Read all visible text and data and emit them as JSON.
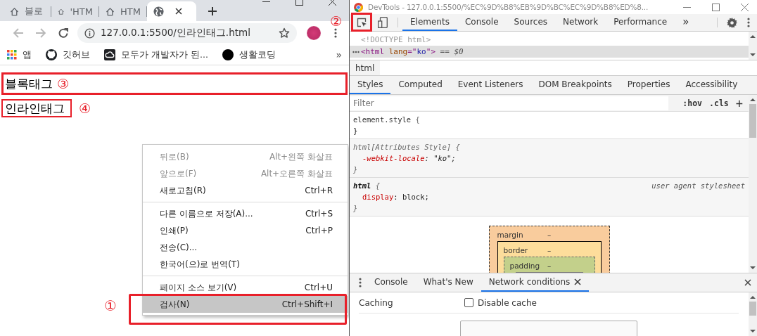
{
  "browser": {
    "tabs": [
      {
        "kind": "home",
        "label": "블로",
        "selected": false,
        "closable": false
      },
      {
        "kind": "home",
        "label": "'HTM",
        "selected": false,
        "closable": false
      },
      {
        "kind": "home",
        "label": "HTM",
        "selected": false,
        "closable": false
      },
      {
        "kind": "globe",
        "selected": true,
        "closable": true
      }
    ],
    "nav": {
      "back_disabled": true,
      "forward_disabled": true
    },
    "address": "127.0.0.1:5500/인라인태그.html",
    "menu_annotation": "②",
    "bookmarks": [
      {
        "kind": "apps",
        "label": "앱"
      },
      {
        "kind": "logo",
        "label": "깃허브"
      },
      {
        "kind": "cloud",
        "label": "모두가 개발자가 된..."
      },
      {
        "kind": "dot",
        "label": "생활코딩"
      }
    ],
    "bookmarks_overflow": "»",
    "page": {
      "block_text": "블록태그",
      "block_annotation": "③",
      "inline_text": "인라인태그",
      "inline_annotation": "④"
    },
    "context_menu": {
      "annotation": "①",
      "groups": [
        {
          "items": [
            {
              "label": "뒤로(B)",
              "shortcut": "Alt+왼쪽 화살표",
              "disabled": true,
              "selected": false
            },
            {
              "label": "앞으로(F)",
              "shortcut": "Alt+오른쪽 화살표",
              "disabled": true,
              "selected": false
            },
            {
              "label": "새로고침(R)",
              "shortcut": "Ctrl+R",
              "disabled": false,
              "selected": false
            }
          ]
        },
        {
          "items": [
            {
              "label": "다른 이름으로 저장(A)...",
              "shortcut": "Ctrl+S",
              "disabled": false,
              "selected": false
            },
            {
              "label": "인쇄(P)",
              "shortcut": "Ctrl+P",
              "disabled": false,
              "selected": false
            },
            {
              "label": "전송(C)...",
              "disabled": false,
              "selected": false
            },
            {
              "label": "한국어(으)로 번역(T)",
              "disabled": false,
              "selected": false
            }
          ]
        },
        {
          "items": [
            {
              "label": "페이지 소스 보기(V)",
              "shortcut": "Ctrl+U",
              "disabled": false,
              "selected": false
            },
            {
              "label": "검사(N)",
              "shortcut": "Ctrl+Shift+I",
              "disabled": false,
              "selected": true
            }
          ]
        }
      ]
    }
  },
  "devtools": {
    "title": "DevTools - 127.0.0.1:5500/%EC%9D%B8%EB%9D%BC%EC%9D%B8%ED%8...",
    "tabs": [
      {
        "label": "Elements",
        "selected": true
      },
      {
        "label": "Console",
        "selected": false
      },
      {
        "label": "Sources",
        "selected": false
      },
      {
        "label": "Network",
        "selected": false
      },
      {
        "label": "Performance",
        "selected": false
      }
    ],
    "tabs_overflow": "»",
    "dom": [
      {
        "selected": false,
        "tokens": [
          {
            "kind": "doctype",
            "text": "<!DOCTYPE html>"
          }
        ]
      },
      {
        "selected": true,
        "tokens": [
          {
            "kind": "tag",
            "text": "<html"
          },
          {
            "kind": "attr",
            "text": " lang"
          },
          {
            "kind": "punct",
            "text": "=\""
          },
          {
            "kind": "value",
            "text": "ko"
          },
          {
            "kind": "punct",
            "text": "\""
          },
          {
            "kind": "tag",
            "text": ">"
          },
          {
            "kind": "marker",
            "text": " == $0"
          }
        ]
      }
    ],
    "breadcrumb": "html",
    "style_tabs": [
      {
        "label": "Styles",
        "selected": true
      },
      {
        "label": "Computed",
        "selected": false
      },
      {
        "label": "Event Listeners",
        "selected": false
      },
      {
        "label": "DOM Breakpoints",
        "selected": false
      },
      {
        "label": "Properties",
        "selected": false
      },
      {
        "label": "Accessibility",
        "selected": false
      }
    ],
    "filter": {
      "placeholder": "Filter",
      "hov": ":hov",
      "cls": ".cls",
      "add": "+"
    },
    "rules": [
      {
        "kind": "inline",
        "selector": "element.style",
        "open": "{",
        "close": "}"
      },
      {
        "kind": "attributes",
        "selector": "html[Attributes Style]",
        "open": "{",
        "declarations": [
          {
            "property": "-webkit-locale",
            "value": ": \"ko\";"
          }
        ],
        "close": "}"
      },
      {
        "kind": "user_agent",
        "selector": "html",
        "open": "{",
        "source": "user agent stylesheet",
        "declarations": [
          {
            "property": "display",
            "value": ": block;"
          }
        ],
        "close": "}"
      }
    ],
    "box_model": {
      "margin": {
        "label": "margin",
        "value": "–"
      },
      "border": {
        "label": "border",
        "value": "–"
      },
      "padding": {
        "label": "padding",
        "value": "–"
      }
    },
    "drawer": {
      "tabs": [
        {
          "label": "Console",
          "selected": false,
          "closable": false
        },
        {
          "label": "What's New",
          "selected": false,
          "closable": false
        },
        {
          "label": "Network conditions",
          "selected": true,
          "closable": true
        }
      ],
      "caching": {
        "label": "Caching",
        "option": {
          "label": "Disable cache",
          "checked": false
        }
      }
    }
  }
}
